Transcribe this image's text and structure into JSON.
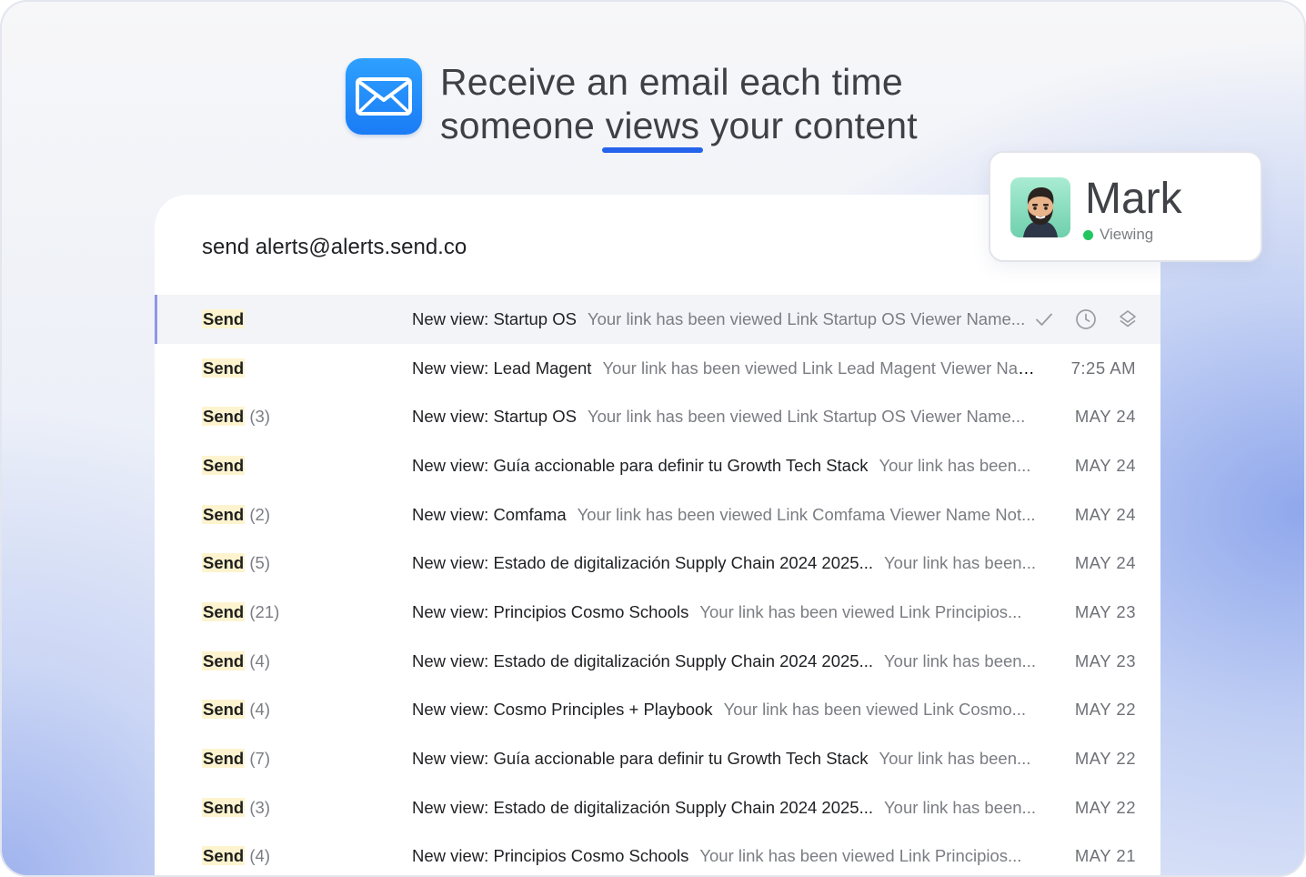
{
  "headline": {
    "line1": "Receive an email each time",
    "line2_pre": "someone ",
    "line2_highlight": "views",
    "line2_post": " your content",
    "icon": "mail-icon"
  },
  "viewer_card": {
    "name": "Mark",
    "status": "Viewing",
    "status_color": "#22c55e"
  },
  "mail": {
    "header": "send alerts@alerts.send.co",
    "row_actions": [
      "check-icon",
      "clock-icon",
      "layers-icon"
    ],
    "rows": [
      {
        "sender": "Send",
        "count": "",
        "subject": "New view: Startup OS",
        "snippet": "Your link has been viewed Link Startup OS Viewer Name...",
        "date": ""
      },
      {
        "sender": "Send",
        "count": "",
        "subject": "New view: Lead Magent",
        "snippet": "Your link has been viewed Link Lead Magent Viewer Name...",
        "date": "7:25 AM"
      },
      {
        "sender": "Send",
        "count": "(3)",
        "subject": "New view: Startup OS",
        "snippet": "Your link has been viewed Link Startup OS Viewer Name...",
        "date": "MAY 24"
      },
      {
        "sender": "Send",
        "count": "",
        "subject": "New view: Guía accionable para definir tu Growth Tech Stack",
        "snippet": "Your link has been...",
        "date": "MAY 24"
      },
      {
        "sender": "Send",
        "count": "(2)",
        "subject": "New view: Comfama",
        "snippet": "Your link has been viewed Link Comfama Viewer Name Not...",
        "date": "MAY 24"
      },
      {
        "sender": "Send",
        "count": "(5)",
        "subject": "New view: Estado de digitalización Supply Chain 2024 2025...",
        "snippet": "Your link has been...",
        "date": "MAY 24"
      },
      {
        "sender": "Send",
        "count": "(21)",
        "subject": "New view: Principios Cosmo Schools",
        "snippet": "Your link has been viewed Link Principios...",
        "date": "MAY 23"
      },
      {
        "sender": "Send",
        "count": "(4)",
        "subject": "New view: Estado de digitalización Supply Chain 2024 2025...",
        "snippet": "Your link has been...",
        "date": "MAY 23"
      },
      {
        "sender": "Send",
        "count": "(4)",
        "subject": "New view: Cosmo Principles + Playbook",
        "snippet": "Your link has been viewed Link Cosmo...",
        "date": "MAY 22"
      },
      {
        "sender": "Send",
        "count": "(7)",
        "subject": "New view: Guía accionable para definir tu Growth Tech Stack",
        "snippet": "Your link has been...",
        "date": "MAY 22"
      },
      {
        "sender": "Send",
        "count": "(3)",
        "subject": "New view: Estado de digitalización Supply Chain 2024 2025...",
        "snippet": "Your link has been...",
        "date": "MAY 22"
      },
      {
        "sender": "Send",
        "count": "(4)",
        "subject": "New view: Principios Cosmo Schools",
        "snippet": "Your link has been viewed Link Principios...",
        "date": "MAY 21"
      }
    ]
  }
}
